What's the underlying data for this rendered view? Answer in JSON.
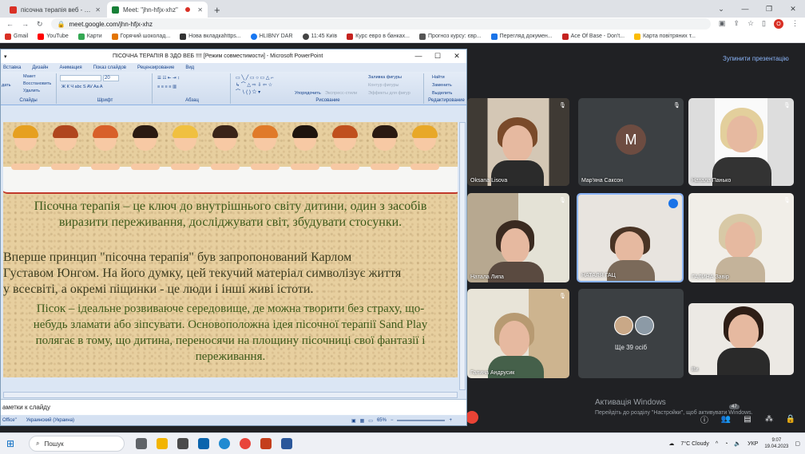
{
  "browser": {
    "tabs": [
      {
        "title": "пісочна терапія веб - pogorelk",
        "color": "#d93025"
      },
      {
        "title": "Meet: \"jhn-hfjx-xhz\"",
        "color": "#188038"
      }
    ],
    "url": "meet.google.com/jhn-hfjx-xhz",
    "avatar_letter": "O",
    "bookmarks": [
      {
        "label": "Gmail",
        "color": "#d93025"
      },
      {
        "label": "YouTube",
        "color": "#ff0000"
      },
      {
        "label": "Карти",
        "color": "#34a853"
      },
      {
        "label": "Горячий шоколад...",
        "color": "#e37400"
      },
      {
        "label": "Нова вкладкаhttps...",
        "color": "#333333"
      },
      {
        "label": "HLIBNY DAR",
        "color": "#1877f2"
      },
      {
        "label": "11:45 Київ",
        "color": "#444444"
      },
      {
        "label": "Курс евро в банках...",
        "color": "#c5221f"
      },
      {
        "label": "Прогноз курсу: євр...",
        "color": "#555555"
      },
      {
        "label": "Перегляд докумен...",
        "color": "#1a73e8"
      },
      {
        "label": "Ace Of Base - Don't...",
        "color": "#c5221f"
      },
      {
        "label": "Карта повітряних т...",
        "color": "#fbbc04"
      }
    ]
  },
  "meet": {
    "stop_presenting": "Зупинити презентацію",
    "participants": [
      {
        "name": "Oksana Lisova"
      },
      {
        "name": "Мар'яна Саксон",
        "initial": "M"
      },
      {
        "name": "Натала Панько"
      },
      {
        "name": "Натала Липа"
      },
      {
        "name": "НАТАЛЯ ГАЦ"
      },
      {
        "name": "ГАЛИНА Завір"
      },
      {
        "name": "Галина Андрусик"
      },
      {
        "name": "Ви"
      }
    ],
    "others_label": "Ще 39 осіб",
    "people_badge": "47",
    "windows_activation_title": "Активація Windows",
    "windows_activation_text": "Перейдіть до розділу \"Настройки\", щоб активувати Windows."
  },
  "ppt": {
    "title": "ПІСОЧНА ТЕРАПІЯ В ЗДО  ВЕБ !!!! [Режим совместимости] - Microsoft PowerPoint",
    "menu": [
      "Вставка",
      "Дизайн",
      "Анимация",
      "Показ слайдов",
      "Рецензирование",
      "Вид"
    ],
    "ribbon": {
      "layout": "Макет",
      "restore": "Восстановить",
      "delete": "Удалить",
      "create": "дать",
      "slides_group": "Слайды",
      "font_group": "Шрифт",
      "font_size": "20",
      "paragraph_group": "Абзац",
      "drawing_group": "Рисование",
      "arrange": "Упорядочить",
      "quick_styles": "Экспресс-стили",
      "fill": "Заливка фигуры",
      "outline": "Контур фигуры",
      "effects": "Эффекты для фигур",
      "find": "Найти",
      "replace": "Заменить",
      "select": "Выделить",
      "editing_group": "Редактирование"
    },
    "slide": {
      "para1": "Пісочна терапія – це ключ до внутрішнього світу дитини, один з засобів виразити переживання, досліджувати світ, збудувати стосунки.",
      "para2_line1": "Вперше принцип \"пісочна терапія\" був запропонований Карлом",
      "para2_line2": "Густавом Юнгом. На його думку, цей текучий матеріал символізує життя",
      "para2_line3": "у всесвіті, а окремі піщинки - це люди і інші живі істоти.",
      "para3": "Пісок – ідеальне розвиваюче середовище, де можна творити без страху, що-небудь зламати або зіпсувати. Основоположна ідея пісочної терапії Sand Play полягає в тому, що дитина, переносячи на площину пісочниці свої фантазії і переживання."
    },
    "notes_placeholder": "аметки к слайду",
    "status_office": "Office\"",
    "status_language": "Украинский (Украина)",
    "zoom": "65%"
  },
  "taskbar": {
    "search_placeholder": "Пошук",
    "weather": "7°C  Cloudy",
    "lang": "УКР",
    "time": "9:07",
    "date": "19.04.2023"
  }
}
